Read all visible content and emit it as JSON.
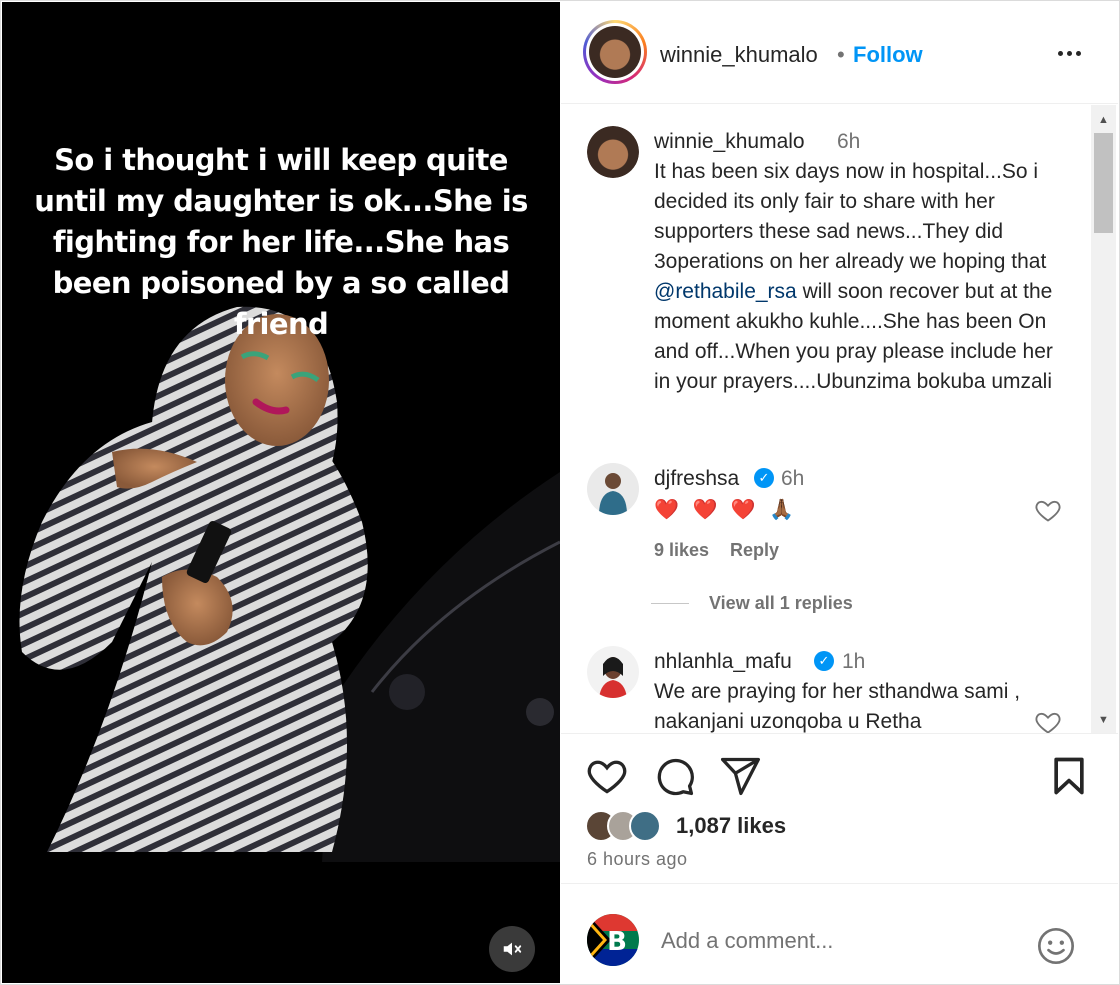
{
  "post": {
    "story_text": "So i thought i will keep quite until my daughter is ok...She is fighting for her life...She has been poisoned by a so called friend",
    "mute_icon": "speaker-muted-icon"
  },
  "header": {
    "username": "winnie_khumalo",
    "separator": "•",
    "follow_label": "Follow",
    "more_icon": "more-options-icon"
  },
  "caption": {
    "username": "winnie_khumalo",
    "time": "6h",
    "text_before": "It has been six days now in hospital...So i decided its only fair to share with her supporters these sad news...They did 3operations on her already we hoping that ",
    "mention": "@rethabile_rsa",
    "text_after": " will soon recover but at the moment akukho kuhle....She has been On and off...When you pray please include her in your prayers....Ubunzima bokuba umzali"
  },
  "comments": [
    {
      "username": "djfreshsa",
      "verified": true,
      "time": "6h",
      "text": "❤️ ❤️ ❤️ 🙏🏾",
      "likes": "9 likes",
      "reply_label": "Reply",
      "view_replies": "View all 1 replies"
    },
    {
      "username": "nhlanhla_mafu",
      "verified": true,
      "time": "1h",
      "text": "We are praying for her sthandwa sami , nakanjani uzonqoba u Retha"
    }
  ],
  "actions": {
    "like_icon": "heart-icon",
    "comment_icon": "comment-icon",
    "share_icon": "send-icon",
    "save_icon": "bookmark-icon",
    "likes_count": "1,087 likes",
    "posted_time": "6 hours ago"
  },
  "add_comment": {
    "placeholder": "Add a comment...",
    "emoji_icon": "emoji-icon"
  },
  "colors": {
    "accent": "#0095f6",
    "secondary_text": "#737373",
    "like_red": "#ed4956"
  }
}
